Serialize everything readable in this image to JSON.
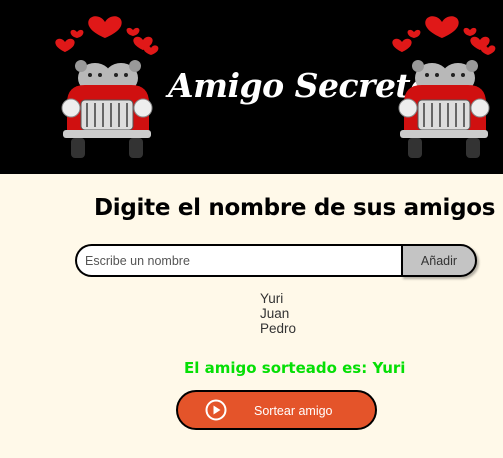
{
  "header": {
    "title": "Amigo Secreto"
  },
  "main": {
    "heading": "Digite el nombre de sus amigos",
    "input": {
      "placeholder": "Escribe un nombre",
      "value": ""
    },
    "add_button_label": "Añadir",
    "friends": [
      "Yuri",
      "Juan",
      "Pedro"
    ],
    "result_text": "El amigo sorteado es: Yuri",
    "draw_button_label": "Sortear amigo",
    "draw_button_icon": "play-circle-icon"
  },
  "colors": {
    "header_bg": "#000000",
    "page_bg": "#fff9e9",
    "accent": "#e4542a",
    "result": "#05df05",
    "add_button_bg": "#c4c4c4"
  }
}
